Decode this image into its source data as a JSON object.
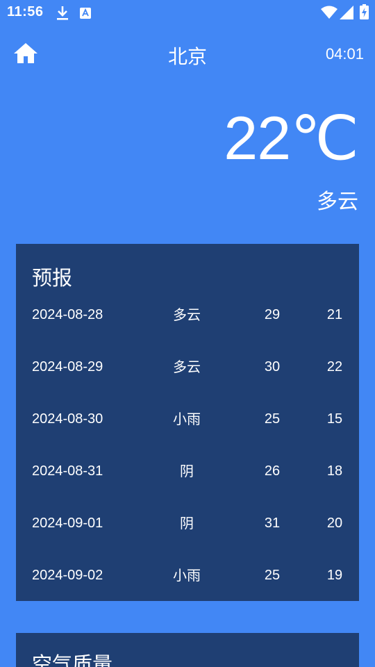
{
  "status_bar": {
    "time": "11:56",
    "icons": [
      "download-icon",
      "a-badge-icon",
      "wifi-icon",
      "signal-icon",
      "battery-charging-icon"
    ]
  },
  "title_bar": {
    "city": "北京",
    "update_time": "04:01",
    "home_icon": "home-icon"
  },
  "now": {
    "temperature": "22℃",
    "info": "多云"
  },
  "forecast": {
    "title": "预报",
    "rows": [
      {
        "date": "2024-08-28",
        "info": "多云",
        "max": "29",
        "min": "21"
      },
      {
        "date": "2024-08-29",
        "info": "多云",
        "max": "30",
        "min": "22"
      },
      {
        "date": "2024-08-30",
        "info": "小雨",
        "max": "25",
        "min": "15"
      },
      {
        "date": "2024-08-31",
        "info": "阴",
        "max": "26",
        "min": "18"
      },
      {
        "date": "2024-09-01",
        "info": "阴",
        "max": "31",
        "min": "20"
      },
      {
        "date": "2024-09-02",
        "info": "小雨",
        "max": "25",
        "min": "19"
      }
    ]
  },
  "aqi": {
    "title": "空气质量"
  },
  "colors": {
    "background": "#4287f5",
    "card": "#1f3f73",
    "text": "#ffffff"
  }
}
